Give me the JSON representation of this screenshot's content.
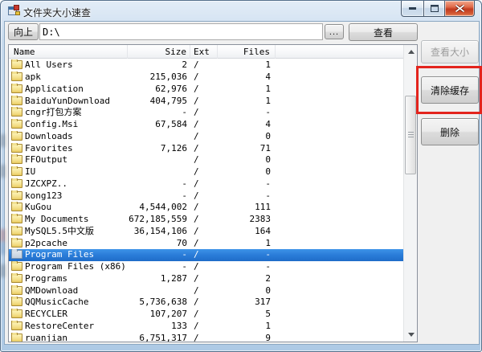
{
  "window": {
    "title": "文件夹大小速查",
    "controls": {
      "minimize": "minimize",
      "maximize": "maximize",
      "close": "close"
    }
  },
  "toolbar": {
    "up_label": "向上",
    "path_value": "D:\\",
    "browse_label": "...",
    "view_label": "查看"
  },
  "list": {
    "columns": [
      {
        "label": "Name",
        "align": "left"
      },
      {
        "label": "Size",
        "align": "right"
      },
      {
        "label": "Ext",
        "align": "left"
      },
      {
        "label": "Files",
        "align": "right"
      }
    ],
    "rows": [
      {
        "name": "All Users",
        "size": "2",
        "ext": "/",
        "files": "1",
        "selected": false
      },
      {
        "name": "apk",
        "size": "215,036",
        "ext": "/",
        "files": "4",
        "selected": false
      },
      {
        "name": "Application",
        "size": "62,976",
        "ext": "/",
        "files": "1",
        "selected": false
      },
      {
        "name": "BaiduYunDownload",
        "size": "404,795",
        "ext": "/",
        "files": "1",
        "selected": false
      },
      {
        "name": "cngr打包方案",
        "size": "-",
        "ext": "/",
        "files": "-",
        "selected": false
      },
      {
        "name": "Config.Msi",
        "size": "67,584",
        "ext": "/",
        "files": "4",
        "selected": false
      },
      {
        "name": "Downloads",
        "size": "",
        "ext": "/",
        "files": "0",
        "selected": false
      },
      {
        "name": "Favorites",
        "size": "7,126",
        "ext": "/",
        "files": "71",
        "selected": false
      },
      {
        "name": "FFOutput",
        "size": "",
        "ext": "/",
        "files": "0",
        "selected": false
      },
      {
        "name": "IU",
        "size": "",
        "ext": "/",
        "files": "0",
        "selected": false
      },
      {
        "name": "JZCXPZ..",
        "size": "-",
        "ext": "/",
        "files": "-",
        "selected": false
      },
      {
        "name": "kong123",
        "size": "-",
        "ext": "/",
        "files": "-",
        "selected": false
      },
      {
        "name": "KuGou",
        "size": "4,544,002",
        "ext": "/",
        "files": "111",
        "selected": false
      },
      {
        "name": "My Documents",
        "size": "672,185,559",
        "ext": "/",
        "files": "2383",
        "selected": false
      },
      {
        "name": "MySQL5.5中文版",
        "size": "36,154,106",
        "ext": "/",
        "files": "164",
        "selected": false
      },
      {
        "name": "p2pcache",
        "size": "70",
        "ext": "/",
        "files": "1",
        "selected": false
      },
      {
        "name": "Program Files",
        "size": "-",
        "ext": "/",
        "files": "-",
        "selected": true
      },
      {
        "name": "Program Files (x86)",
        "size": "-",
        "ext": "/",
        "files": "-",
        "selected": false
      },
      {
        "name": "Programs",
        "size": "1,287",
        "ext": "/",
        "files": "2",
        "selected": false
      },
      {
        "name": "QMDownload",
        "size": "",
        "ext": "/",
        "files": "0",
        "selected": false
      },
      {
        "name": "QQMusicCache",
        "size": "5,736,638",
        "ext": "/",
        "files": "317",
        "selected": false
      },
      {
        "name": "RECYCLER",
        "size": "107,207",
        "ext": "/",
        "files": "5",
        "selected": false
      },
      {
        "name": "RestoreCenter",
        "size": "133",
        "ext": "/",
        "files": "1",
        "selected": false
      },
      {
        "name": "ruanjian",
        "size": "6,751,317",
        "ext": "/",
        "files": "9",
        "selected": false
      }
    ]
  },
  "side": {
    "view_size_label": "查看大小",
    "clear_cache_label": "清除缓存",
    "delete_label": "删除"
  },
  "colors": {
    "selection_blue": "#2a7cd8",
    "annotation_red": "#e3241d",
    "disabled_text": "#9c9c9c",
    "frame_blue": "#b9d1e9"
  }
}
